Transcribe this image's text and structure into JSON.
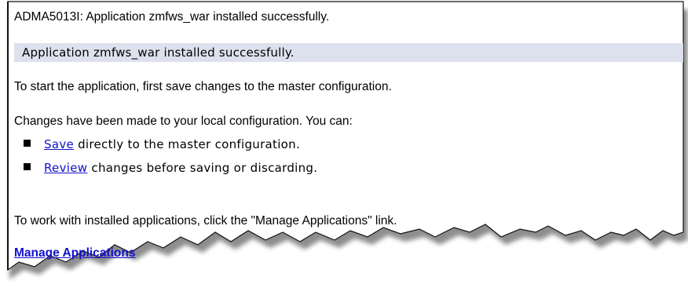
{
  "messages": {
    "install_code_line": "ADMA5013I: Application zmfws_war installed successfully.",
    "status_bar": "Application zmfws_war installed successfully.",
    "start_hint": "To start the application, first save changes to the master configuration.",
    "changes_intro": "Changes have been made to your local configuration. You can:",
    "work_hint": "To work with installed applications, click the \"Manage Applications\" link."
  },
  "options": [
    {
      "link": "Save",
      "rest": " directly to the master configuration."
    },
    {
      "link": "Review",
      "rest": " changes before saving or discarding."
    }
  ],
  "manage_link": "Manage Applications",
  "colors": {
    "link": "#1111cc",
    "status_bar_bg": "#dde1ee",
    "shadow": "#7a7a7a"
  }
}
